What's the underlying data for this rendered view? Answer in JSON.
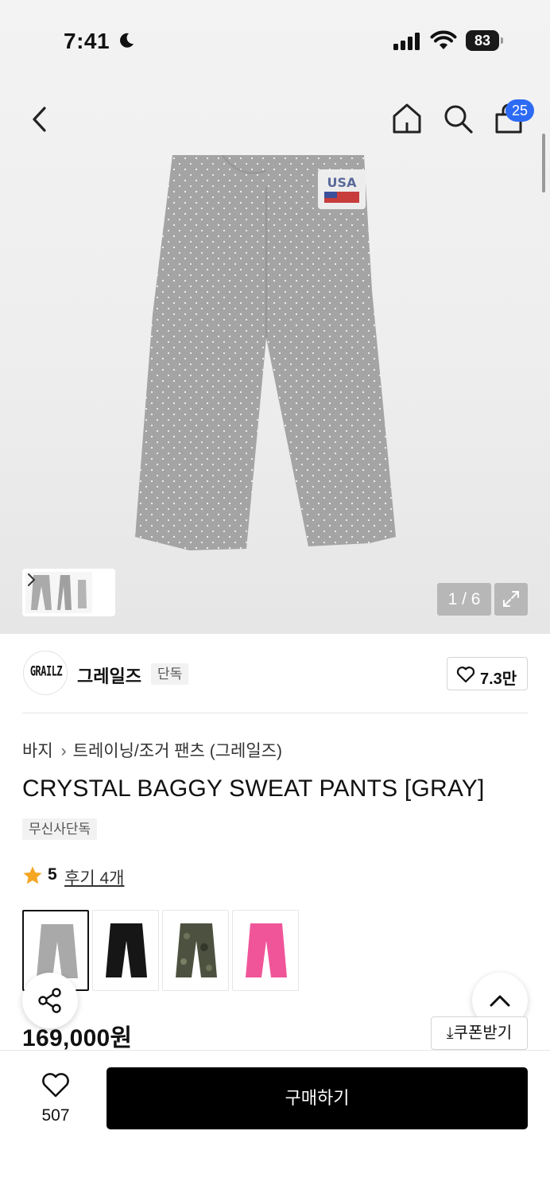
{
  "status_bar": {
    "time": "7:41",
    "battery": "83"
  },
  "nav": {
    "cart_count": "25"
  },
  "gallery": {
    "page_indicator": "1 / 6"
  },
  "brand": {
    "logo_text": "GRAILZ",
    "name": "그레일즈",
    "tag": "단독",
    "likes": "7.3만"
  },
  "breadcrumb": {
    "category": "바지",
    "subcategory": "트레이닝/조거 팬츠 (그레일즈)"
  },
  "product": {
    "title": "CRYSTAL BAGGY SWEAT PANTS [GRAY]",
    "badge": "무신사단독",
    "rating": "5",
    "review_label": "후기 4개",
    "price": "169,000원",
    "coupon_label": "쿠폰받기",
    "color_options": [
      {
        "name": "gray",
        "color": "#a9a9a9",
        "selected": true
      },
      {
        "name": "black",
        "color": "#161616",
        "selected": false
      },
      {
        "name": "camo",
        "color": "#4d5240",
        "selected": false
      },
      {
        "name": "pink",
        "color": "#f0559a",
        "selected": false
      }
    ]
  },
  "bottom_bar": {
    "wish_count": "507",
    "buy_label": "구매하기"
  },
  "colors": {
    "accent_badge": "#2d6bf5",
    "star": "#f5a623",
    "buy_button": "#000000"
  }
}
